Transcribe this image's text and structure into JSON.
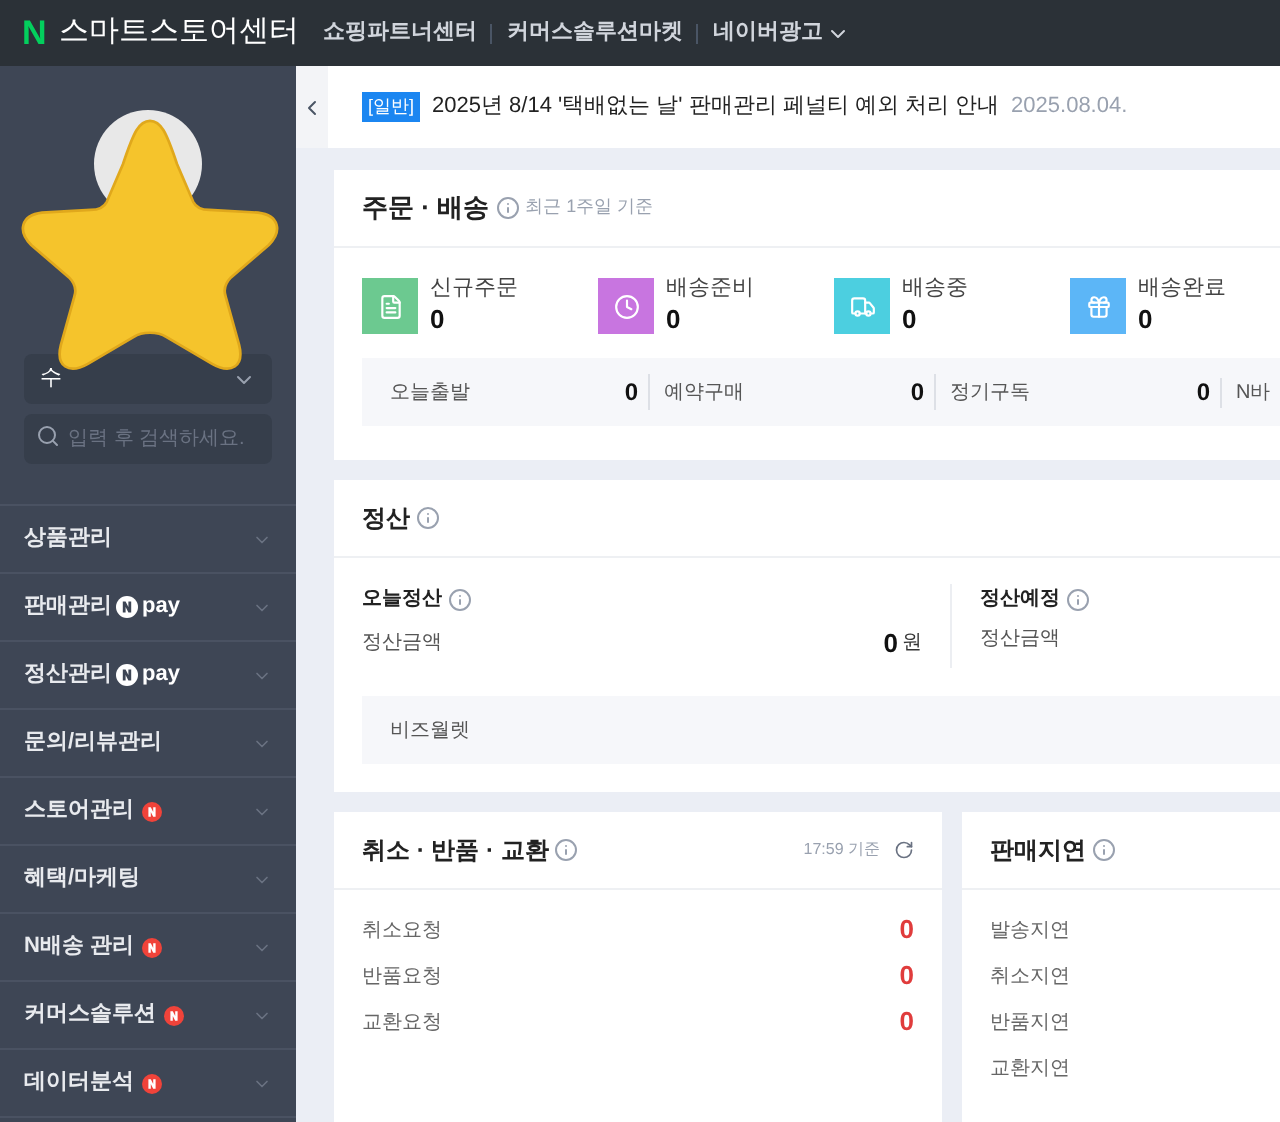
{
  "topbar": {
    "logo_mark": "N",
    "logo_text": "스마트스토어센터",
    "links": [
      {
        "label": "쇼핑파트너센터",
        "dropdown": false
      },
      {
        "label": "커머스솔루션마켓",
        "dropdown": false
      },
      {
        "label": "네이버광고",
        "dropdown": true
      }
    ]
  },
  "sidebar": {
    "select_value": "수",
    "search": {
      "placeholder": "입력 후 검색하세요."
    },
    "menu": [
      {
        "label": "상품관리",
        "kind": "plain"
      },
      {
        "label": "판매관리",
        "kind": "pay",
        "badge": "pay"
      },
      {
        "label": "정산관리",
        "kind": "pay",
        "badge": "pay"
      },
      {
        "label": "문의/리뷰관리",
        "kind": "plain"
      },
      {
        "label": "스토어관리",
        "kind": "new"
      },
      {
        "label": "혜택/마케팅",
        "kind": "plain"
      },
      {
        "label": "N배송 관리",
        "kind": "new"
      },
      {
        "label": "커머스솔루션",
        "kind": "new"
      },
      {
        "label": "데이터분석",
        "kind": "new"
      }
    ]
  },
  "notice": {
    "tag": "[일반]",
    "text": "2025년 8/14 '택배없는 날' 판매관리 페널티 예외 처리 안내",
    "date": "2025.08.04."
  },
  "orders": {
    "title": "주문 · 배송",
    "subtitle": "최근 1주일 기준",
    "stats": [
      {
        "label": "신규주문",
        "value": "0",
        "color": "#6cc990"
      },
      {
        "label": "배송준비",
        "value": "0",
        "color": "#c875e0"
      },
      {
        "label": "배송중",
        "value": "0",
        "color": "#4ccfe0"
      },
      {
        "label": "배송완료",
        "value": "0",
        "color": "#5cb6f7"
      }
    ],
    "sub": [
      {
        "label": "오늘출발",
        "value": "0"
      },
      {
        "label": "예약구매",
        "value": "0"
      },
      {
        "label": "정기구독",
        "value": "0"
      },
      {
        "label": "N바"
      }
    ]
  },
  "settlement": {
    "title": "정산",
    "today": {
      "title": "오늘정산",
      "label": "정산금액",
      "value": "0",
      "unit": "원"
    },
    "scheduled": {
      "title": "정산예정",
      "label": "정산금액"
    },
    "wallet": "비즈월렛"
  },
  "claims": {
    "title": "취소 · 반품 · 교환",
    "time": "17:59 기준",
    "rows": [
      {
        "label": "취소요청",
        "value": "0"
      },
      {
        "label": "반품요청",
        "value": "0"
      },
      {
        "label": "교환요청",
        "value": "0"
      }
    ]
  },
  "delays": {
    "title": "판매지연",
    "rows": [
      "발송지연",
      "취소지연",
      "반품지연",
      "교환지연"
    ]
  }
}
